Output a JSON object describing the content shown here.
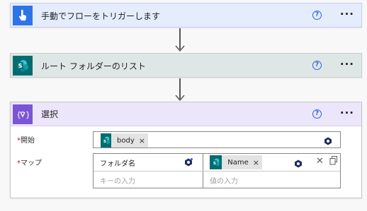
{
  "steps": {
    "trigger": {
      "title": "手動でフローをトリガーします",
      "icon": "touch-hand-icon",
      "help": "?",
      "more": "···",
      "color": "#2e74e8"
    },
    "list_folder": {
      "title": "ルート フォルダーのリスト",
      "icon": "sharepoint-icon",
      "help": "?",
      "more": "···",
      "color": "#036c70"
    },
    "select": {
      "title": "選択",
      "icon": "data-operation-icon",
      "help": "?",
      "more": "···",
      "color": "#7a55d6"
    }
  },
  "select_form": {
    "from_label": "開始",
    "required_mark": "*",
    "from_token": "body",
    "map_label": "マップ",
    "map_key": "フォルダ名",
    "map_value_token": "Name",
    "key_placeholder": "キーの入力",
    "value_placeholder": "値の入力",
    "token_remove": "×"
  }
}
